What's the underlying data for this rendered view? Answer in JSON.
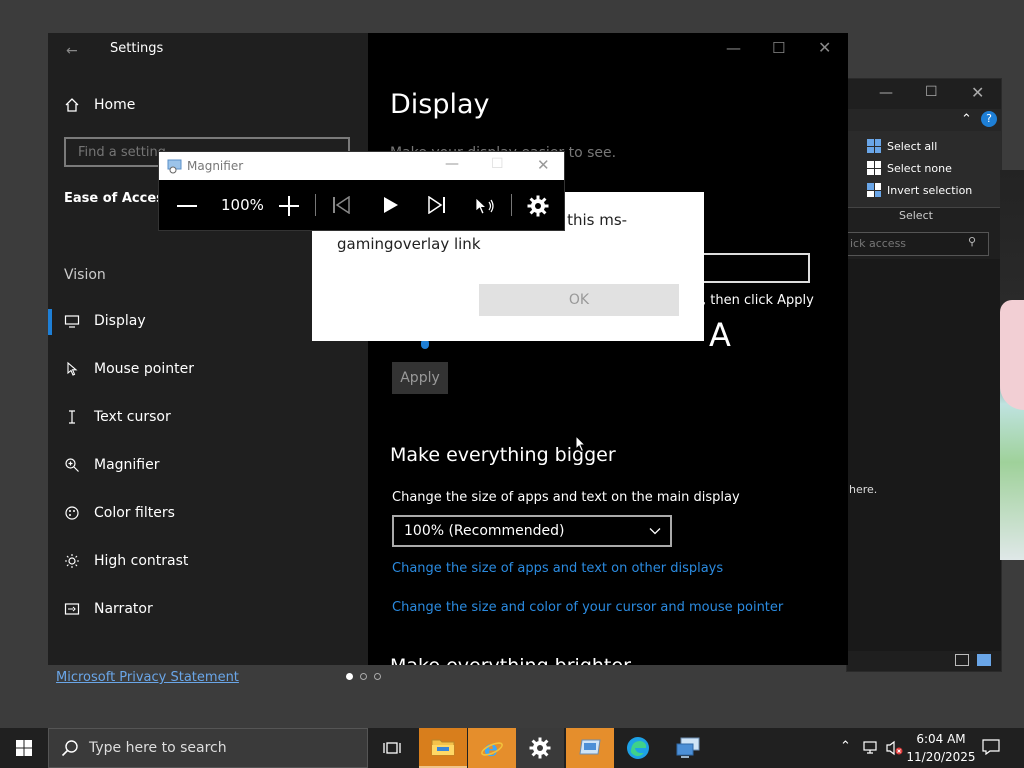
{
  "explorer": {
    "ribbon_items": [
      "Select all",
      "Select none",
      "Invert selection"
    ],
    "group_label": "Select",
    "search_placeholder": "ick access",
    "hint_text": "here."
  },
  "settings": {
    "title": "Settings",
    "home_label": "Home",
    "find_placeholder": "Find a setting",
    "section_title": "Ease of Access",
    "vision_label": "Vision",
    "nav_items": [
      {
        "label": "Display",
        "icon": "monitor-icon"
      },
      {
        "label": "Mouse pointer",
        "icon": "mouse-pointer-icon"
      },
      {
        "label": "Text cursor",
        "icon": "text-cursor-icon"
      },
      {
        "label": "Magnifier",
        "icon": "magnifier-icon"
      },
      {
        "label": "Color filters",
        "icon": "color-filters-icon"
      },
      {
        "label": "High contrast",
        "icon": "high-contrast-icon"
      },
      {
        "label": "Narrator",
        "icon": "narrator-icon"
      }
    ],
    "page_title": "Display",
    "faded_text": "Make your display easier to see.",
    "apply_hint": ", then click Apply",
    "big_a": "A",
    "apply_label": "Apply",
    "section_bigger": "Make everything bigger",
    "scale_label": "Change the size of apps and text on the main display",
    "scale_value": "100% (Recommended)",
    "link_other_displays": "Change the size of apps and text on other displays",
    "link_cursor": "Change the size and color of your cursor and mouse pointer",
    "next_heading": "Make everything brighter"
  },
  "privacy_link": "Microsoft Privacy Statement",
  "dialog": {
    "message": "You'll need a new app to open this ms-gamingoverlay link",
    "ok_label": "OK"
  },
  "magnifier": {
    "title": "Magnifier",
    "zoom": "100%"
  },
  "taskbar": {
    "search_placeholder": "Type here to search",
    "time": "6:04 AM",
    "date": "11/20/2025"
  },
  "colors": {
    "accent": "#1e7fd6",
    "link": "#2b8be0",
    "taskbar_active": "#e58e2c"
  }
}
